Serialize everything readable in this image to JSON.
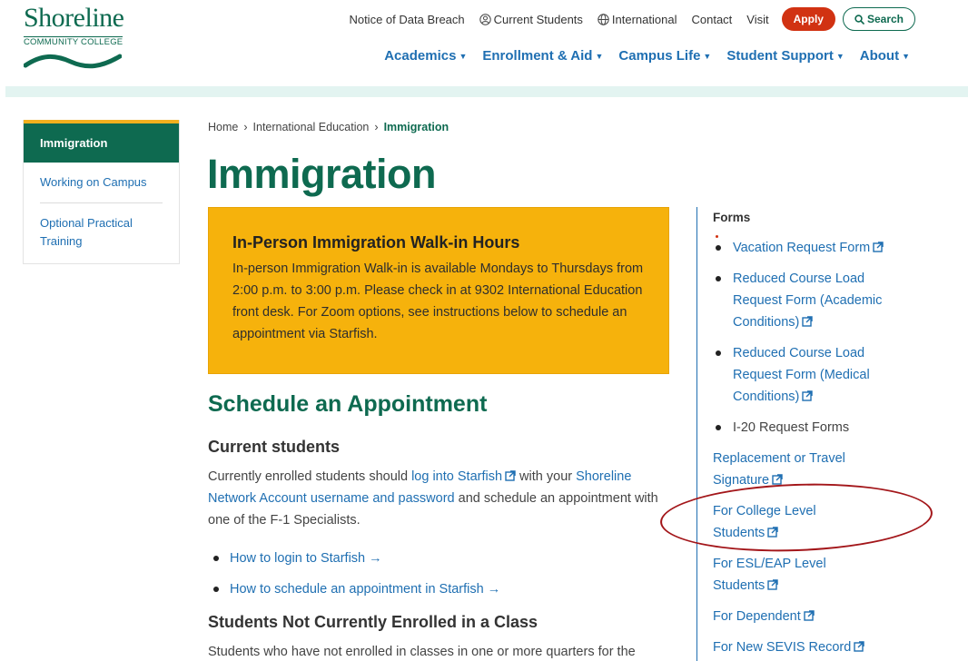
{
  "logo": {
    "name": "Shoreline",
    "sub": "COMMUNITY COLLEGE"
  },
  "utility_nav": [
    {
      "label": "Notice of Data Breach",
      "icon": ""
    },
    {
      "label": "Current Students",
      "icon": "user-circle-icon"
    },
    {
      "label": "International",
      "icon": "globe-icon"
    },
    {
      "label": "Contact",
      "icon": ""
    },
    {
      "label": "Visit",
      "icon": ""
    }
  ],
  "apply_label": "Apply",
  "search_label": "Search",
  "main_nav": [
    "Academics",
    "Enrollment & Aid",
    "Campus Life",
    "Student Support",
    "About"
  ],
  "sidebar": {
    "active": "Immigration",
    "items": [
      "Working on Campus",
      "Optional Practical Training"
    ]
  },
  "breadcrumb": [
    "Home",
    "International Education",
    "Immigration"
  ],
  "page_title": "Immigration",
  "callout": {
    "title": "In-Person Immigration Walk-in Hours",
    "body": "In-person Immigration Walk-in is available Mondays to Thursdays from 2:00 p.m. to 3:00 p.m. Please check in at 9302 International Education front desk. For Zoom options, see instructions below to schedule an appointment via Starfish."
  },
  "section": {
    "heading": "Schedule an Appointment",
    "current_students": {
      "heading": "Current students",
      "text_1": "Currently enrolled students should ",
      "link_1": "log into Starfish",
      "text_2": " with your ",
      "link_2": "Shoreline Network Account username and password",
      "text_3": " and schedule an appointment with one of the F-1 Specialists."
    },
    "links": [
      "How to login to Starfish →",
      "How to schedule an appointment in Starfish →"
    ],
    "not_enrolled": {
      "heading": "Students Not Currently Enrolled in a Class",
      "text": "Students who have not enrolled in classes in one or more quarters for the"
    }
  },
  "aside": {
    "title": "Forms",
    "items": [
      "Vacation Request Form",
      "Reduced Course Load Request Form (Academic Conditions)",
      "Reduced Course Load Request Form (Medical Conditions)"
    ],
    "group_label": "I-20 Request Forms",
    "sub_items": [
      "Replacement or Travel Signature",
      "For College Level Students",
      "For ESL/EAP Level Students",
      "For Dependent",
      "For New SEVIS Record"
    ]
  },
  "colors": {
    "brand": "#0e6a50",
    "accent": "#f6b20c",
    "apply": "#d13212",
    "link": "#1f6fb2",
    "annotation": "#a3161a"
  }
}
